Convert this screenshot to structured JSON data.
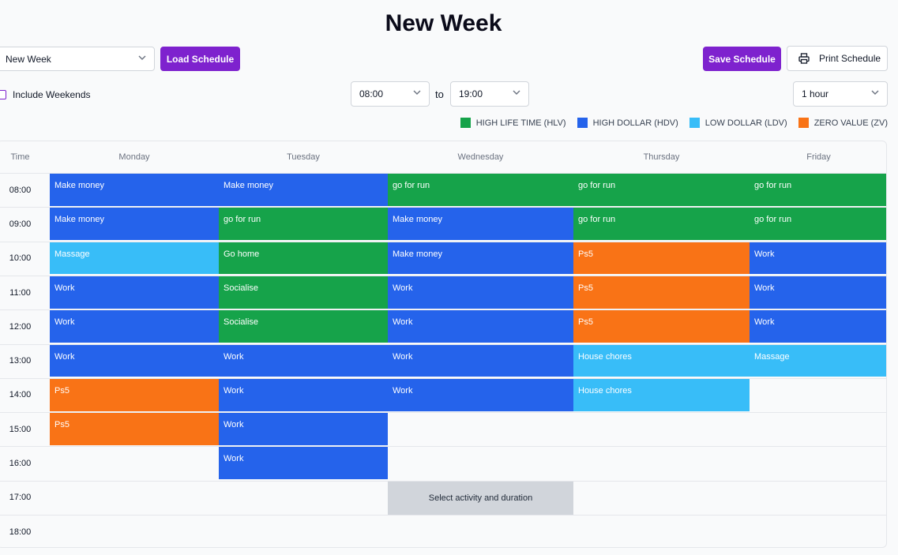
{
  "page": {
    "title": "New Week"
  },
  "toolbar": {
    "schedule_select_value": "New Week",
    "load_label": "Load Schedule",
    "save_label": "Save Schedule",
    "print_label": "Print Schedule",
    "include_weekends_label": "Include Weekends",
    "start_time": "08:00",
    "to_label": "to",
    "end_time": "19:00",
    "interval": "1 hour"
  },
  "colors": {
    "HLV": "#16a34a",
    "HDV": "#2563eb",
    "LDV": "#38bdf8",
    "ZV": "#f97316",
    "accent": "#7e22ce"
  },
  "legend": [
    {
      "key": "HLV",
      "label": "HIGH LIFE TIME (HLV)"
    },
    {
      "key": "HDV",
      "label": "HIGH DOLLAR (HDV)"
    },
    {
      "key": "LDV",
      "label": "LOW DOLLAR (LDV)"
    },
    {
      "key": "ZV",
      "label": "ZERO VALUE (ZV)"
    }
  ],
  "grid": {
    "time_header": "Time",
    "days": [
      "Monday",
      "Tuesday",
      "Wednesday",
      "Thursday",
      "Friday"
    ],
    "times": [
      "08:00",
      "09:00",
      "10:00",
      "11:00",
      "12:00",
      "13:00",
      "14:00",
      "15:00",
      "16:00",
      "17:00",
      "18:00"
    ],
    "placeholder_label": "Select activity and duration",
    "placeholder_cell": {
      "day": 2,
      "time": 9
    },
    "entries": [
      {
        "day": 0,
        "time": 0,
        "label": "Make money",
        "cat": "HDV"
      },
      {
        "day": 1,
        "time": 0,
        "label": "Make money",
        "cat": "HDV"
      },
      {
        "day": 2,
        "time": 0,
        "label": "go for run",
        "cat": "HLV"
      },
      {
        "day": 3,
        "time": 0,
        "label": "go for run",
        "cat": "HLV"
      },
      {
        "day": 4,
        "time": 0,
        "label": "go for run",
        "cat": "HLV"
      },
      {
        "day": 0,
        "time": 1,
        "label": "Make money",
        "cat": "HDV"
      },
      {
        "day": 1,
        "time": 1,
        "label": "go for run",
        "cat": "HLV"
      },
      {
        "day": 2,
        "time": 1,
        "label": "Make money",
        "cat": "HDV"
      },
      {
        "day": 3,
        "time": 1,
        "label": "go for run",
        "cat": "HLV"
      },
      {
        "day": 4,
        "time": 1,
        "label": "go for run",
        "cat": "HLV"
      },
      {
        "day": 0,
        "time": 2,
        "label": "Massage",
        "cat": "LDV"
      },
      {
        "day": 1,
        "time": 2,
        "label": "Go home",
        "cat": "HLV"
      },
      {
        "day": 2,
        "time": 2,
        "label": "Make money",
        "cat": "HDV"
      },
      {
        "day": 3,
        "time": 2,
        "label": "Ps5",
        "cat": "ZV"
      },
      {
        "day": 4,
        "time": 2,
        "label": "Work",
        "cat": "HDV"
      },
      {
        "day": 0,
        "time": 3,
        "label": "Work",
        "cat": "HDV"
      },
      {
        "day": 1,
        "time": 3,
        "label": "Socialise",
        "cat": "HLV"
      },
      {
        "day": 2,
        "time": 3,
        "label": "Work",
        "cat": "HDV"
      },
      {
        "day": 3,
        "time": 3,
        "label": "Ps5",
        "cat": "ZV"
      },
      {
        "day": 4,
        "time": 3,
        "label": "Work",
        "cat": "HDV"
      },
      {
        "day": 0,
        "time": 4,
        "label": "Work",
        "cat": "HDV"
      },
      {
        "day": 1,
        "time": 4,
        "label": "Socialise",
        "cat": "HLV"
      },
      {
        "day": 2,
        "time": 4,
        "label": "Work",
        "cat": "HDV"
      },
      {
        "day": 3,
        "time": 4,
        "label": "Ps5",
        "cat": "ZV"
      },
      {
        "day": 4,
        "time": 4,
        "label": "Work",
        "cat": "HDV"
      },
      {
        "day": 0,
        "time": 5,
        "label": "Work",
        "cat": "HDV"
      },
      {
        "day": 1,
        "time": 5,
        "label": "Work",
        "cat": "HDV"
      },
      {
        "day": 2,
        "time": 5,
        "label": "Work",
        "cat": "HDV"
      },
      {
        "day": 3,
        "time": 5,
        "label": "House chores",
        "cat": "LDV"
      },
      {
        "day": 4,
        "time": 5,
        "label": "Massage",
        "cat": "LDV"
      },
      {
        "day": 0,
        "time": 6,
        "label": "Ps5",
        "cat": "ZV"
      },
      {
        "day": 1,
        "time": 6,
        "label": "Work",
        "cat": "HDV"
      },
      {
        "day": 2,
        "time": 6,
        "label": "Work",
        "cat": "HDV"
      },
      {
        "day": 3,
        "time": 6,
        "label": "House chores",
        "cat": "LDV"
      },
      {
        "day": 0,
        "time": 7,
        "label": "Ps5",
        "cat": "ZV"
      },
      {
        "day": 1,
        "time": 7,
        "label": "Work",
        "cat": "HDV"
      },
      {
        "day": 1,
        "time": 8,
        "label": "Work",
        "cat": "HDV"
      }
    ]
  }
}
